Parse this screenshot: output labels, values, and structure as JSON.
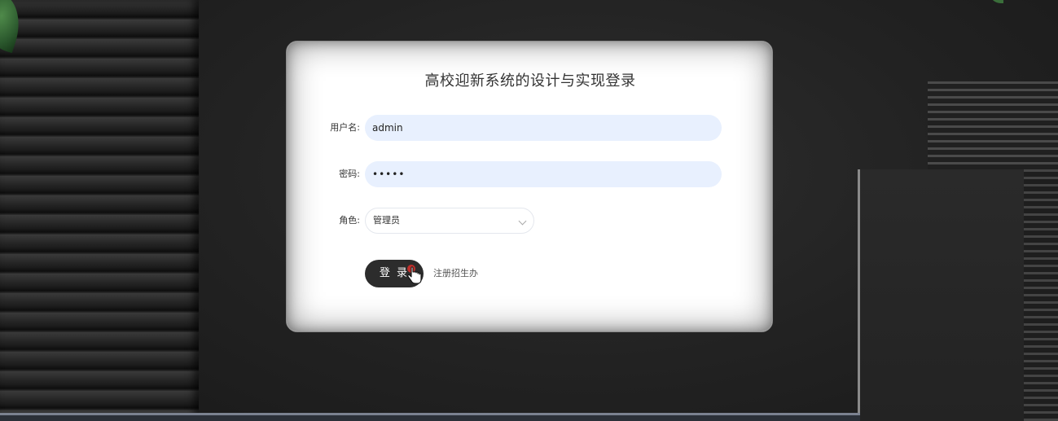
{
  "login": {
    "title": "高校迎新系统的设计与实现登录",
    "username_label": "用户名:",
    "username_value": "admin",
    "password_label": "密码:",
    "password_value": "•••••",
    "role_label": "角色:",
    "role_value": "管理员",
    "login_button": "登 录",
    "register_link": "注册招生办"
  },
  "icons": {
    "dropdown": "chevron-down-icon",
    "cursor": "hand-pointer-icon"
  },
  "colors": {
    "button_bg": "#2c2c2c",
    "field_bg": "#e8f0fe",
    "card_bg": "#ffffff"
  }
}
